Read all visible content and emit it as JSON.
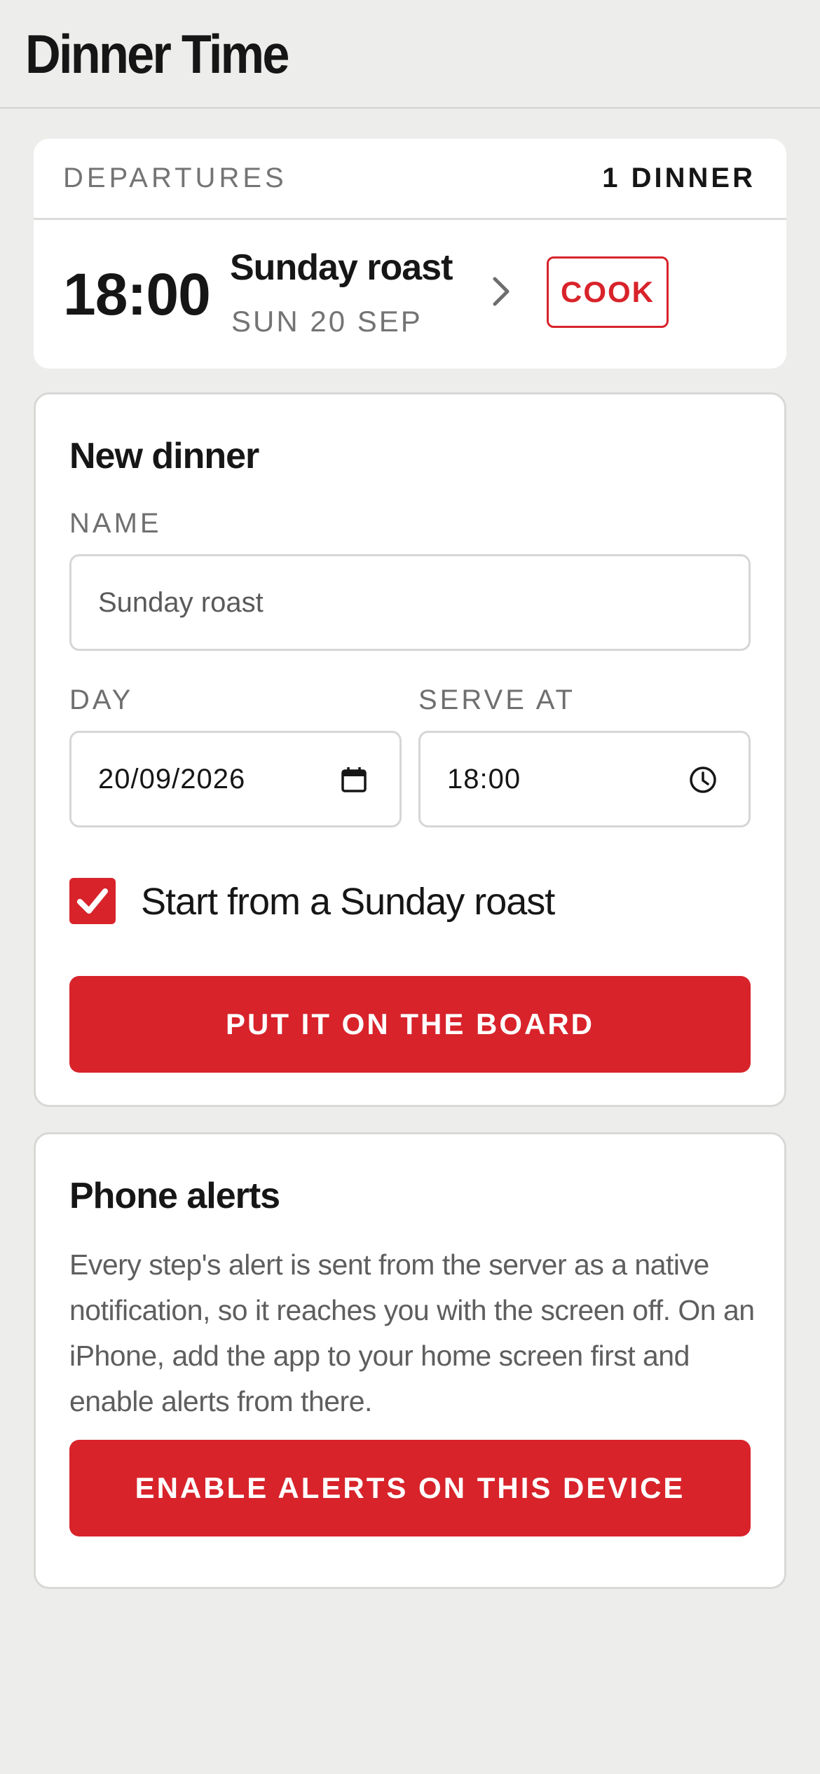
{
  "app": {
    "title": "Dinner Time"
  },
  "departures": {
    "label": "DEPARTURES",
    "count": "1 DINNER",
    "items": [
      {
        "time": "18:00",
        "name": "Sunday roast",
        "date": "SUN 20 SEP",
        "action": "COOK"
      }
    ]
  },
  "new_dinner": {
    "title": "New dinner",
    "name_label": "NAME",
    "name_placeholder": "Sunday roast",
    "day_label": "DAY",
    "day_value": "20/09/2026",
    "serve_label": "SERVE AT",
    "serve_value": "18:00",
    "checkbox_label": "Start from a Sunday roast",
    "checkbox_checked": true,
    "submit_label": "PUT IT ON THE BOARD"
  },
  "alerts": {
    "title": "Phone alerts",
    "description": "Every step's alert is sent from the server as a native notification, so it reaches you with the screen off. On an iPhone, add the app to your home screen first and enable alerts from there.",
    "button_label": "ENABLE ALERTS ON THIS DEVICE"
  },
  "colors": {
    "accent": "#d8232b",
    "background": "#ededeb",
    "card": "#ffffff",
    "muted_text": "#747474"
  },
  "icons": {
    "chevron": "chevron-right-icon",
    "calendar": "calendar-icon",
    "clock": "clock-icon",
    "check": "check-icon"
  }
}
